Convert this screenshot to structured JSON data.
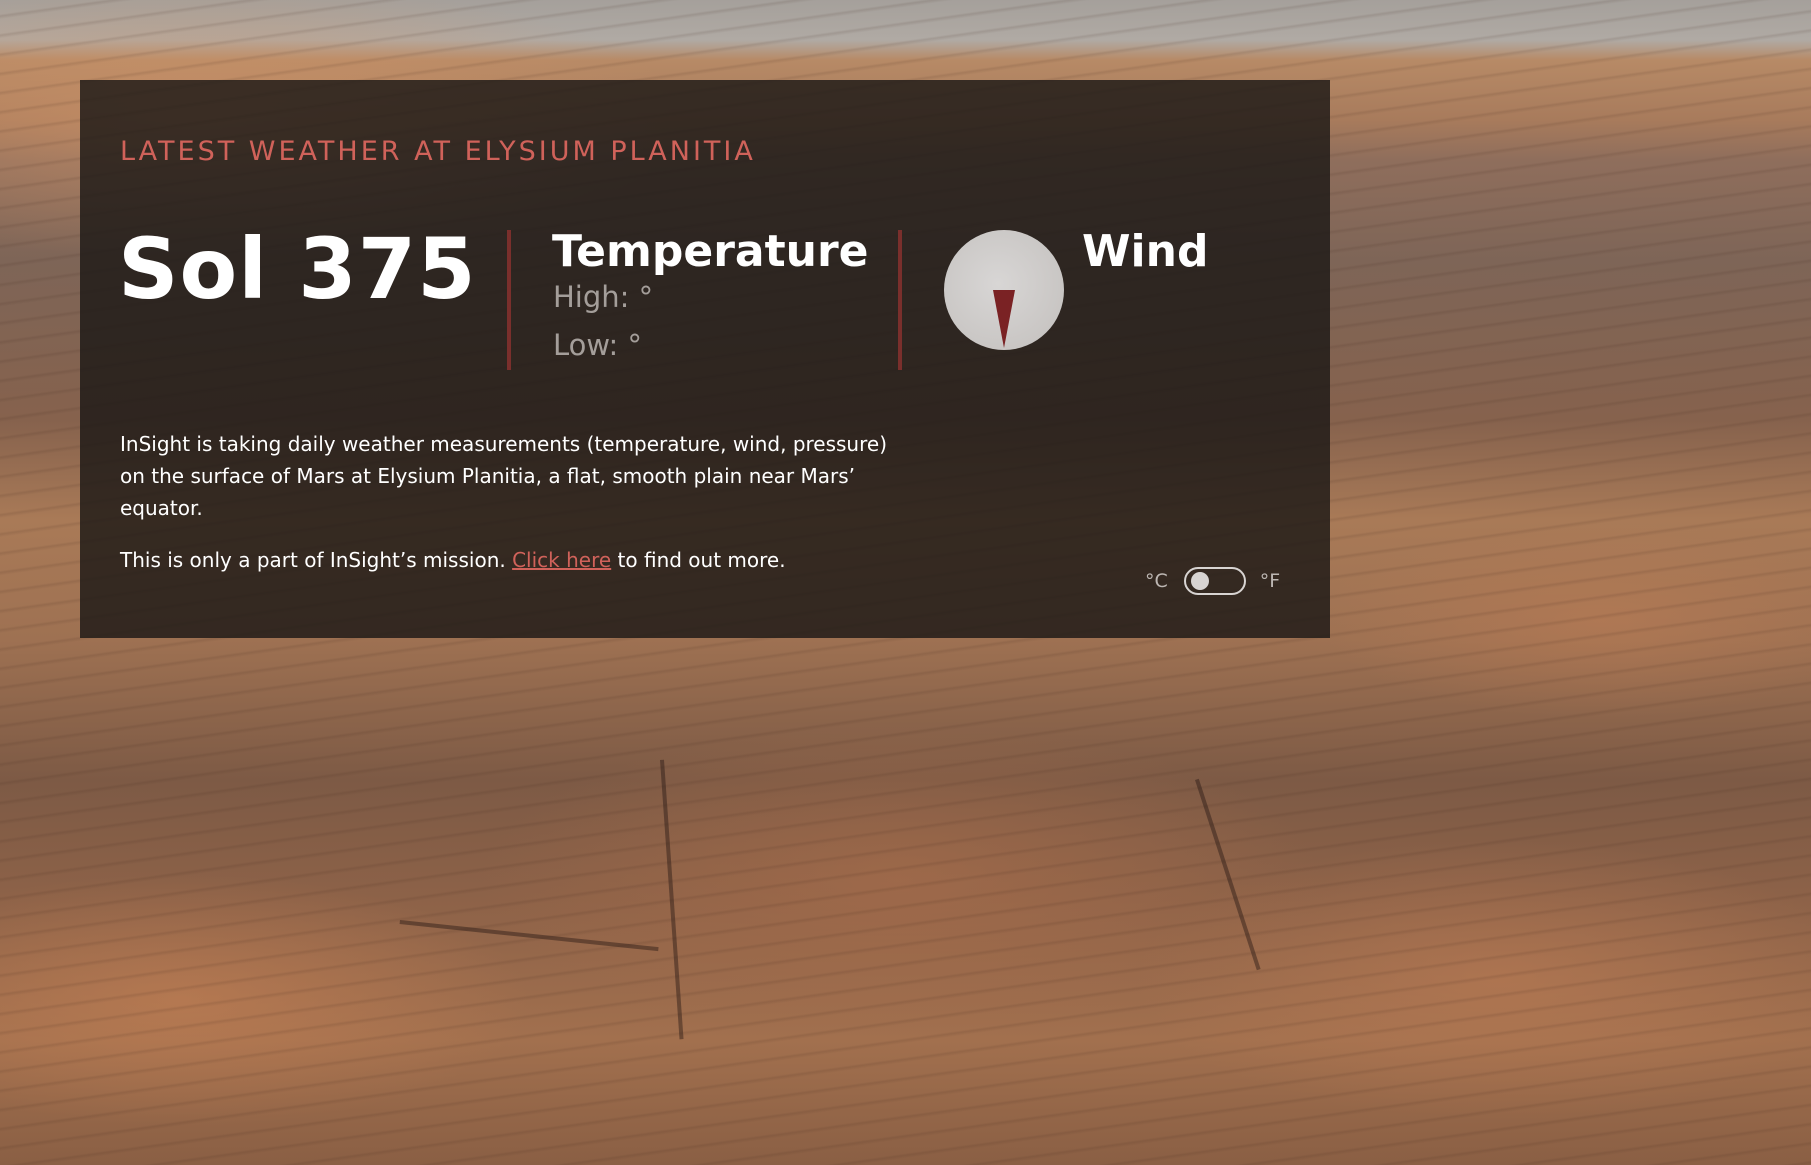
{
  "header": {
    "headline": "LATEST WEATHER AT ELYSIUM PLANITIA"
  },
  "sol": {
    "label": "Sol 375"
  },
  "temperature": {
    "title": "Temperature",
    "high": "High: °",
    "low": "Low: °"
  },
  "wind": {
    "title": "Wind",
    "compass_icon": "wind-compass-icon"
  },
  "info": {
    "paragraph1": "InSight is taking daily weather measurements (temperature, wind, pressure) on the surface of Mars at Elysium Planitia, a flat, smooth plain near Mars’ equator.",
    "paragraph2_before": "This is only a part of InSight’s mission. ",
    "paragraph2_link": "Click here",
    "paragraph2_after": " to find out more."
  },
  "units": {
    "celsius": "°C",
    "fahrenheit": "°F",
    "selected": "°C"
  },
  "colors": {
    "accent": "#d0625a",
    "divider": "#7a2f2c",
    "panel_bg": "#1c1816"
  }
}
